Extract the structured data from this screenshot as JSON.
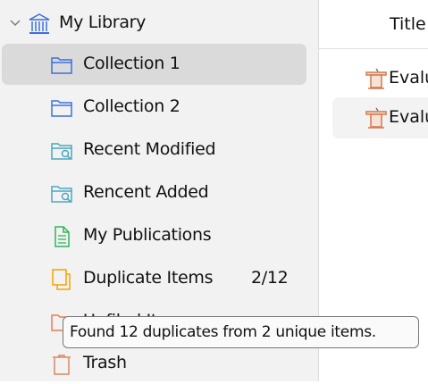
{
  "sidebar": {
    "library": {
      "label": "My Library",
      "icon": "library-icon",
      "expanded": true
    },
    "items": [
      {
        "label": "Collection 1",
        "icon": "folder-icon",
        "selected": true
      },
      {
        "label": "Collection 2",
        "icon": "folder-icon"
      },
      {
        "label": "Recent Modified",
        "icon": "saved-search-icon"
      },
      {
        "label": "Rencent Added",
        "icon": "saved-search-icon"
      },
      {
        "label": "My Publications",
        "icon": "publications-icon"
      },
      {
        "label": "Duplicate Items",
        "icon": "duplicate-icon",
        "count": "2/12"
      },
      {
        "label": "Unfiled Items",
        "icon": "unfiled-icon"
      },
      {
        "label": "Trash",
        "icon": "trash-icon"
      }
    ]
  },
  "main": {
    "column_header": "Title",
    "rows": [
      {
        "title": "Evalu",
        "icon": "presentation-icon"
      },
      {
        "title": "Evalu",
        "icon": "presentation-icon"
      }
    ]
  },
  "tooltip": {
    "text": "Found 12 duplicates from 2 unique items."
  },
  "colors": {
    "folder": "#3b6fe0",
    "search": "#4aa7c0",
    "publications": "#2fb55a",
    "duplicate": "#f5a300",
    "unfiled": "#f07a50",
    "trash": "#d98860",
    "presentation": "#d4784a"
  }
}
